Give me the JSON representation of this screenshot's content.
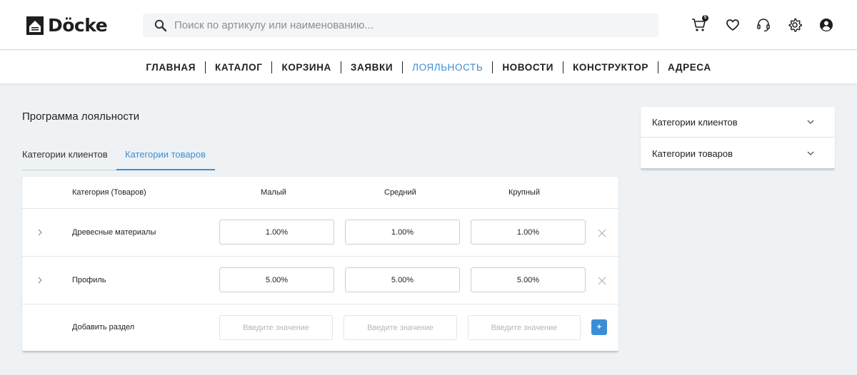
{
  "header": {
    "logo_text": "Döcke",
    "search_placeholder": "Поиск по артикулу или наименованию...",
    "cart_count": "5",
    "accent_color": "#3b8ed6"
  },
  "nav": {
    "items": [
      {
        "label": "ГЛАВНАЯ"
      },
      {
        "label": "КАТАЛОГ"
      },
      {
        "label": "КОРЗИНА"
      },
      {
        "label": "ЗАЯВКИ"
      },
      {
        "label": "ЛОЯЛЬНОСТЬ",
        "active": true
      },
      {
        "label": "НОВОСТИ"
      },
      {
        "label": "КОНСТРУКТОР"
      },
      {
        "label": "АДРЕСА"
      }
    ]
  },
  "main": {
    "title": "Программа лояльности",
    "tabs": [
      {
        "label": "Категории клиентов"
      },
      {
        "label": "Категории товаров",
        "active": true
      }
    ],
    "table": {
      "headers": [
        "Категория (Товаров)",
        "Малый",
        "Средний",
        "Крупный"
      ],
      "rows": [
        {
          "label": "Древесные материалы",
          "values": [
            "1.00%",
            "1.00%",
            "1.00%"
          ]
        },
        {
          "label": "Профиль",
          "values": [
            "5.00%",
            "5.00%",
            "5.00%"
          ]
        }
      ],
      "add_row": {
        "label": "Добавить раздел",
        "placeholder": "Введите значение",
        "button_label": "+"
      }
    }
  },
  "sidebar": {
    "accordion": [
      {
        "label": "Категории клиентов"
      },
      {
        "label": "Категории товаров"
      }
    ]
  }
}
